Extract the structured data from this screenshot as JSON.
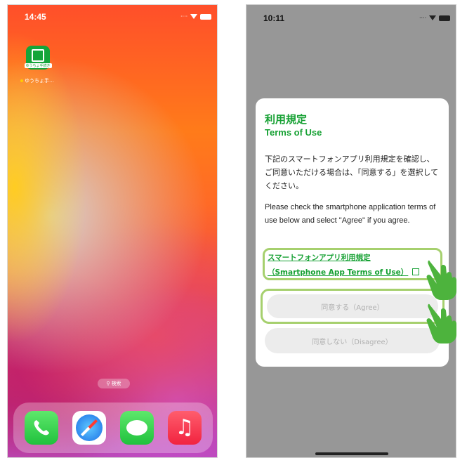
{
  "left_phone": {
    "status_time": "14:45",
    "app": {
      "icon_text": "ゆうちょ手続き",
      "label": "ゆうちょ手…"
    },
    "search_label": "検索",
    "dock": [
      "phone-icon",
      "safari-icon",
      "messages-icon",
      "music-icon"
    ]
  },
  "right_phone": {
    "status_time": "10:11",
    "dialog": {
      "title_jp": "利用規定",
      "title_en": "Terms of Use",
      "body_jp": "下記のスマートフォンアプリ利用規定を確認し、ご同意いただける場合は、「同意する」を選択してください。",
      "body_en": "Please check the smartphone application terms of use below and select \"Agree\" if you agree.",
      "link_line1": "スマートフォンアプリ利用規定",
      "link_line2": "（Smartphone App Terms of Use）",
      "agree_label": "同意する（Agree）",
      "disagree_label": "同意しない（Disagree）"
    }
  },
  "colors": {
    "accent_green": "#17a134",
    "highlight": "#a6d06e",
    "overlay": "#979797"
  }
}
